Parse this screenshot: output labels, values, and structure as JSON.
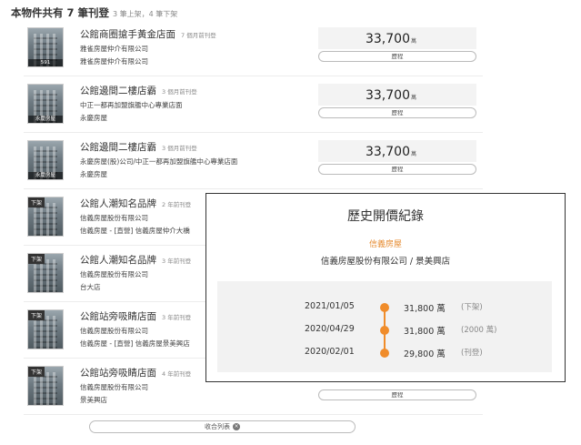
{
  "header": {
    "summary": "本物件共有 7 筆刊登",
    "sub": "3 筆上架，4 筆下架"
  },
  "listings": [
    {
      "title": "公館商圈搶手黃金店面",
      "ago": "7 個月前刊登",
      "line1": "雅雀房屋仲介有限公司",
      "line2": "雅雀房屋仲介有限公司",
      "price": "33,700",
      "unit": "萬",
      "history": "歷程",
      "thumb_tag": "",
      "thumb_caption": "591"
    },
    {
      "title": "公館邊間二樓店霸",
      "ago": "3 個月前刊登",
      "line1": "中正一都再加盟旗艦中心專業店面",
      "line2": "永慶房屋",
      "price": "33,700",
      "unit": "萬",
      "history": "歷程",
      "thumb_tag": "",
      "thumb_caption": "永慶房屋"
    },
    {
      "title": "公館邊間二樓店霸",
      "ago": "3 個月前刊登",
      "line1": "永慶房屋(股)公司/中正一都再加盟旗艦中心專業店面",
      "line2": "永慶房屋",
      "price": "33,700",
      "unit": "萬",
      "history": "歷程",
      "thumb_tag": "",
      "thumb_caption": "永慶房屋"
    },
    {
      "title": "公館人潮知名品牌",
      "ago": "2 年前刊登",
      "line1": "信義房屋股份有限公司",
      "line2": "信義房屋 - [直營] 信義房屋仲介大橋",
      "price": "",
      "unit": "",
      "history": "",
      "thumb_tag": "下架",
      "thumb_caption": ""
    },
    {
      "title": "公館人潮知名品牌",
      "ago": "3 年前刊登",
      "line1": "信義房屋股份有限公司",
      "line2": "台大店",
      "price": "",
      "unit": "",
      "history": "",
      "thumb_tag": "下架",
      "thumb_caption": ""
    },
    {
      "title": "公館站旁吸睛店面",
      "ago": "3 年前刊登",
      "line1": "信義房屋股份有限公司",
      "line2": "信義房屋 - [直營] 信義房屋景美興店",
      "price": "",
      "unit": "",
      "history": "",
      "thumb_tag": "下架",
      "thumb_caption": ""
    },
    {
      "title": "公館站旁吸睛店面",
      "ago": "4 年前刊登",
      "line1": "信義房屋股份有限公司",
      "line2": "景美興店",
      "price": "",
      "unit": "",
      "history": "歷程",
      "thumb_tag": "下架",
      "thumb_caption": ""
    }
  ],
  "collapse": {
    "label": "收合列表",
    "icon": "close-icon"
  },
  "popup": {
    "title": "歷史開價紀錄",
    "brand": "信義房屋",
    "company": "信義房屋股份有限公司 / 景美興店",
    "history": [
      {
        "date": "2021/01/05",
        "price": "31,800 萬",
        "note": "(下架)"
      },
      {
        "date": "2020/04/29",
        "price": "31,800 萬",
        "note": "(2000 萬)"
      },
      {
        "date": "2020/02/01",
        "price": "29,800 萬",
        "note": "(刊登)"
      }
    ]
  },
  "colors": {
    "accent": "#f08c2a",
    "brand_text": "#e68a2e"
  }
}
